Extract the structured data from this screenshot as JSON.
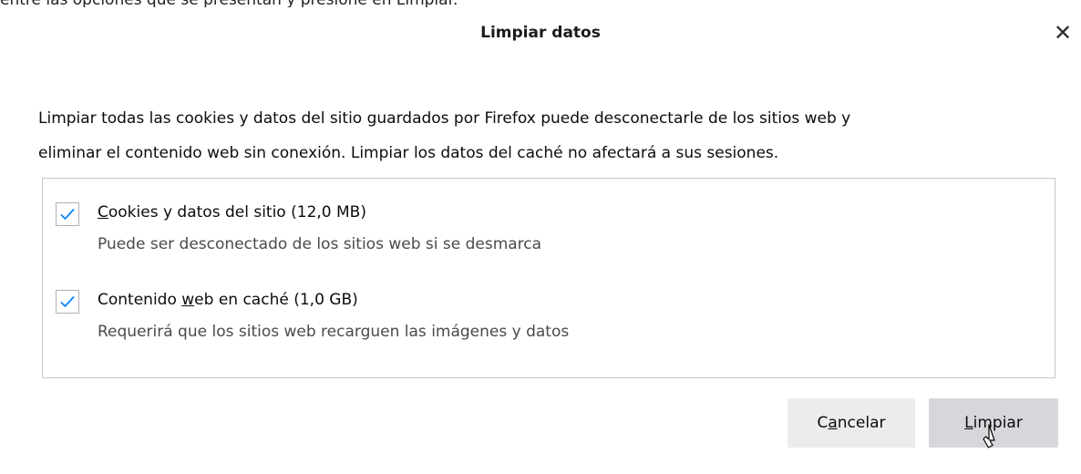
{
  "top_fragment": "entre las opciones que se presentan y presione en Limpiar.",
  "dialog": {
    "title": "Limpiar datos",
    "close_glyph": "✕",
    "description_line1": "Limpiar todas las cookies y datos del sitio guardados por Firefox puede desconectarle de los sitios web y",
    "description_line2": "eliminar el contenido web sin conexión. Limpiar los datos del caché no afectará a sus sesiones."
  },
  "options": [
    {
      "checked": true,
      "label_pre": "",
      "label_accel": "C",
      "label_post": "ookies y datos del sitio (12,0 MB)",
      "description": "Puede ser desconectado de los sitios web si se desmarca"
    },
    {
      "checked": true,
      "label_pre": "Contenido ",
      "label_accel": "w",
      "label_post": "eb en caché (1,0 GB)",
      "description": "Requerirá que los sitios web recarguen las imágenes y datos"
    }
  ],
  "buttons": {
    "cancel_pre": "C",
    "cancel_accel": "a",
    "cancel_post": "ncelar",
    "clear_pre": "",
    "clear_accel": "L",
    "clear_post": "impiar"
  },
  "colors": {
    "checkmark": "#0a84ff",
    "border": "#c8c8c8",
    "cancel_bg": "#ececec",
    "clear_bg": "#d7d7db"
  },
  "icons": {
    "close": "close-icon",
    "check": "checkmark-icon",
    "cursor": "mouse-pointer-icon"
  }
}
